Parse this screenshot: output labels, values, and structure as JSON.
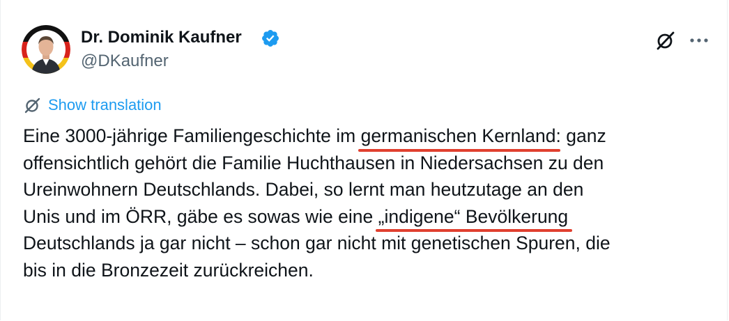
{
  "author": {
    "display_name": "Dr. Dominik Kaufner",
    "handle": "@DKaufner",
    "verified": true
  },
  "actions": {
    "grok_icon": "grok-icon",
    "more_icon": "more-icon"
  },
  "translation": {
    "label": "Show translation"
  },
  "tweet": {
    "line1_pre": "Eine 3000-jährige Familiengeschichte im ",
    "line1_mark": "germanischen Kernland",
    "line1_post": ": ganz",
    "line2": "offensichtlich gehört die Familie Huchthausen in Niedersachsen zu den",
    "line3": "Ureinwohnern Deutschlands. Dabei, so lernt man heutzutage an den",
    "line4_pre": "Unis und im ÖRR, gäbe es sowas wie eine ",
    "line4_mark": "„indigene“ Bevölkerung",
    "line5": "Deutschlands ja gar nicht – schon gar nicht mit genetischen Spuren, die",
    "line6": "bis in die Bronzezeit zurückreichen."
  },
  "colors": {
    "link": "#1d9bf0",
    "secondary_text": "#536471",
    "highlight_underline": "#e0402f",
    "verified_badge": "#1d9bf0"
  }
}
